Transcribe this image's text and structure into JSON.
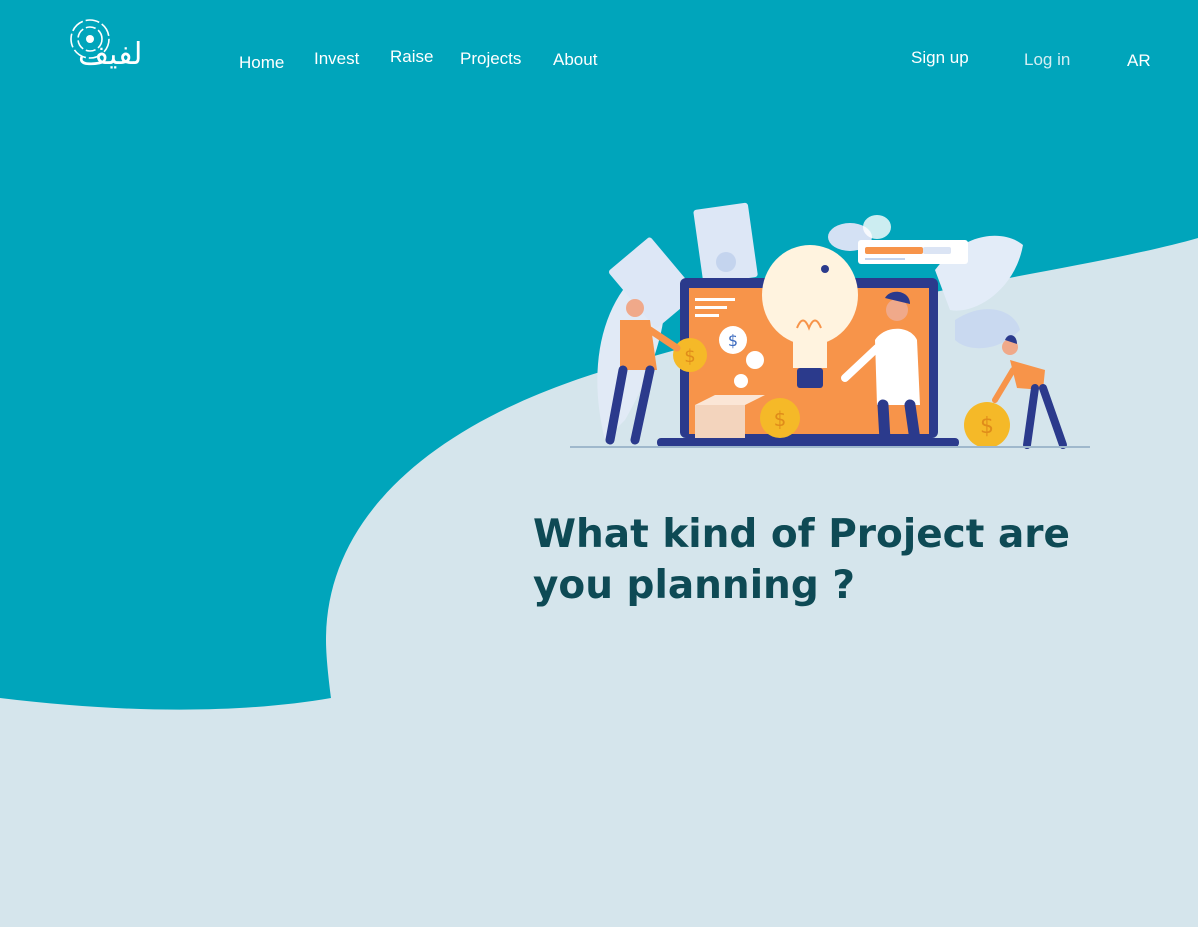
{
  "brand": {
    "logo_text": "لفيف"
  },
  "nav": {
    "home": "Home",
    "invest": "Invest",
    "raise": "Raise",
    "projects": "Projects",
    "about": "About",
    "signup": "Sign up",
    "login": "Log in",
    "language": "AR"
  },
  "hero": {
    "headline": "What kind of Project are you planning ?"
  },
  "colors": {
    "primary": "#00a5bb",
    "background": "#d5e5ec",
    "headline": "#0e4a55",
    "accent_orange": "#f7944a",
    "accent_navy": "#2b3a8c",
    "coin": "#f5b928"
  }
}
